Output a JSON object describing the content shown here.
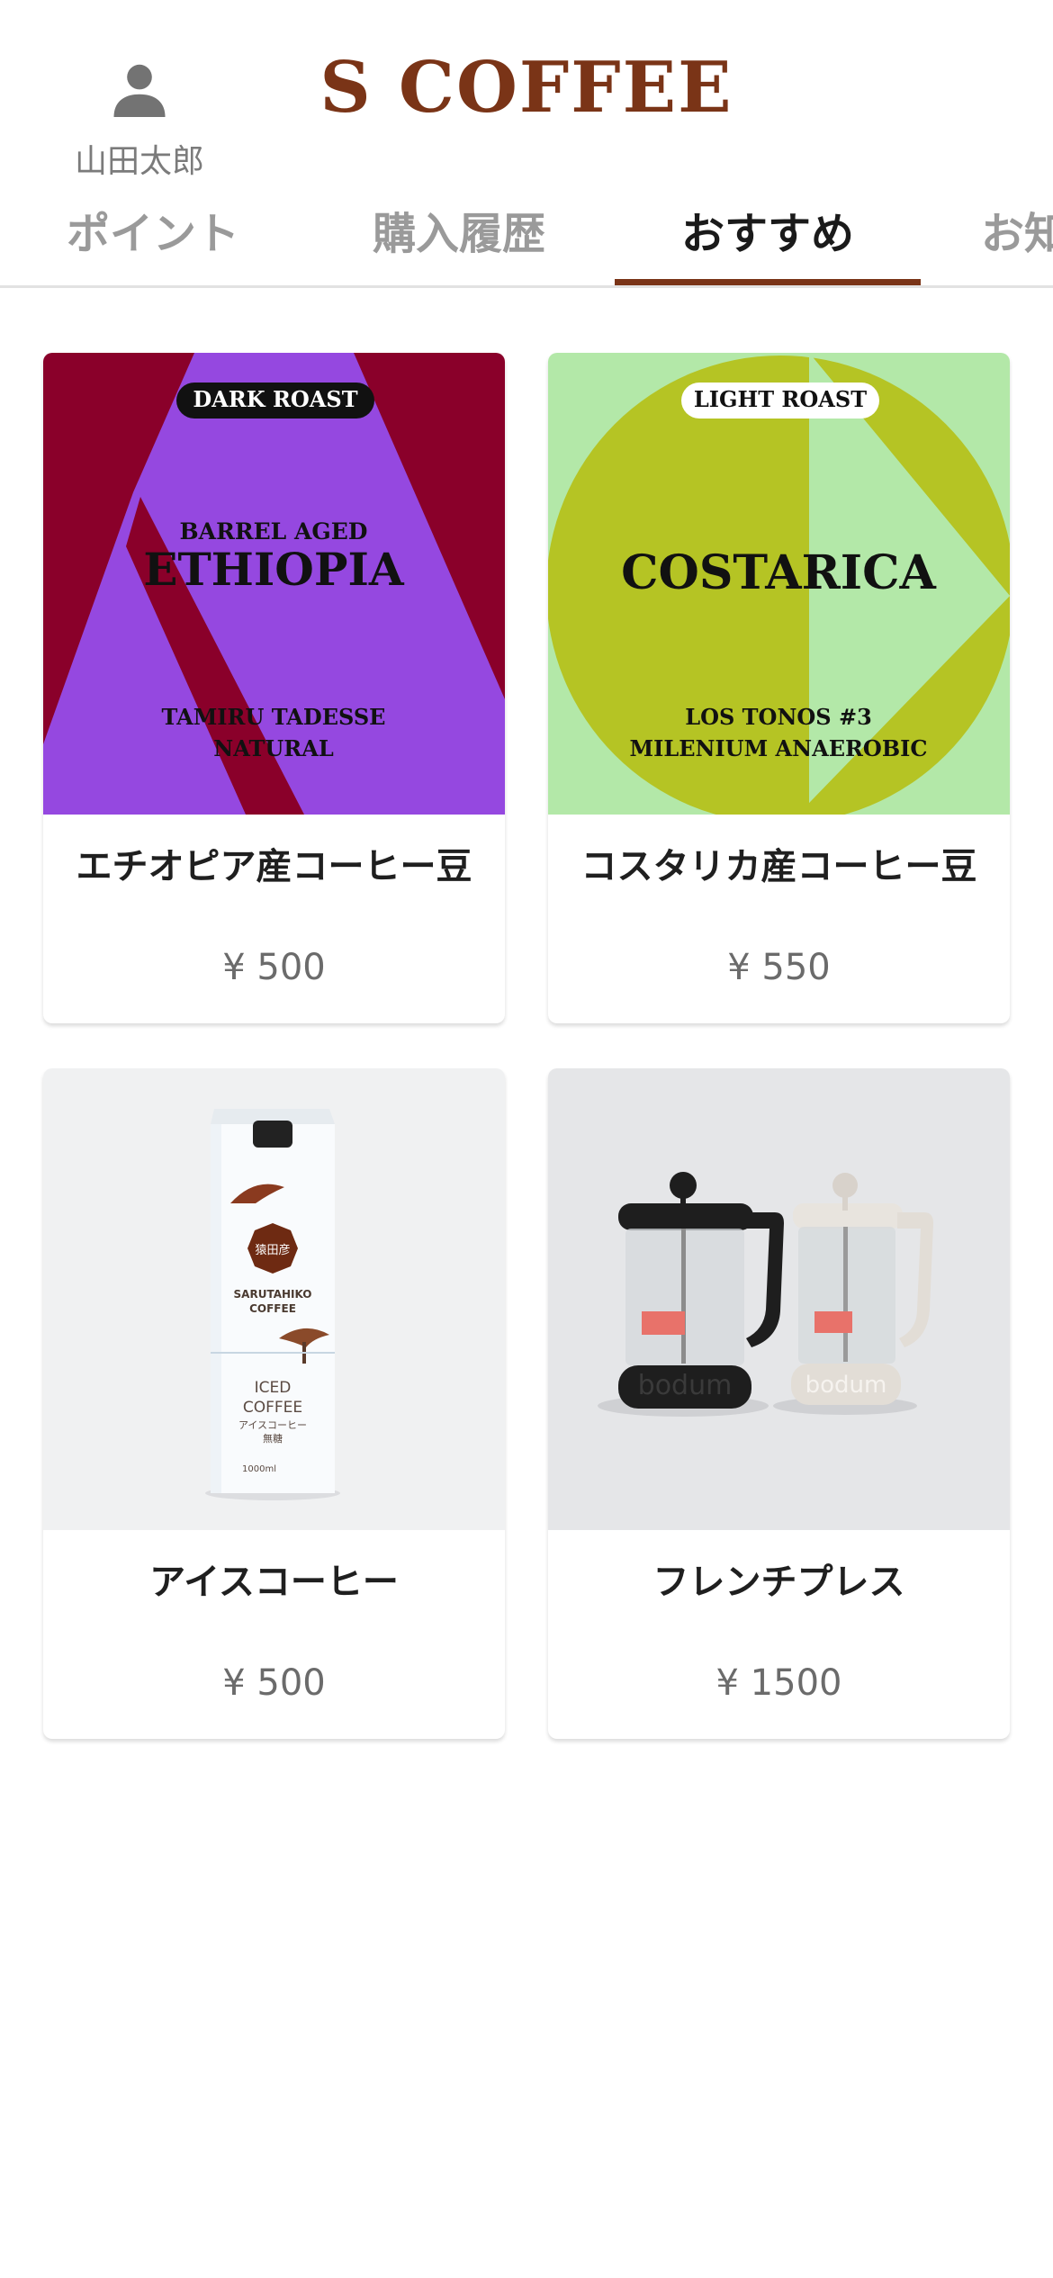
{
  "header": {
    "brand": "S COFFEE",
    "user_name": "山田太郎",
    "user_icon": "person-icon"
  },
  "tabs": [
    {
      "label": "ポイント",
      "active": false
    },
    {
      "label": "購入履歴",
      "active": false
    },
    {
      "label": "おすすめ",
      "active": true
    },
    {
      "label": "お知",
      "active": false
    }
  ],
  "products": [
    {
      "name": "エチオピア産コーヒー豆",
      "price": "¥ 500",
      "image": {
        "badge": "DARK ROAST",
        "line1": "BARREL AGED",
        "line2": "ETHIOPIA",
        "line3": "TAMIRU TADESSE",
        "line4": "NATURAL",
        "colors": {
          "bg": "#8a002a",
          "shape": "#9548e0",
          "badge_bg": "#111111"
        }
      }
    },
    {
      "name": "コスタリカ産コーヒー豆",
      "price": "¥ 550",
      "image": {
        "badge": "LIGHT ROAST",
        "line1": "COSTARICA",
        "line2": "LOS TONOS #3",
        "line3": "MILENIUM ANAEROBIC",
        "colors": {
          "bg": "#b3e8a8",
          "shape": "#b5c424",
          "badge_bg": "#ffffff"
        }
      }
    },
    {
      "name": "アイスコーヒー",
      "price": "¥ 500",
      "image": {
        "seal": "猿田彦",
        "brand1": "SARUTAHIKO",
        "brand2": "COFFEE",
        "label1": "ICED",
        "label2": "COFFEE",
        "label3": "アイスコーヒー",
        "label4": "無糖",
        "volume": "1000ml"
      }
    },
    {
      "name": "フレンチプレス",
      "price": "¥ 1500",
      "image": {
        "brand": "bodum"
      }
    }
  ]
}
